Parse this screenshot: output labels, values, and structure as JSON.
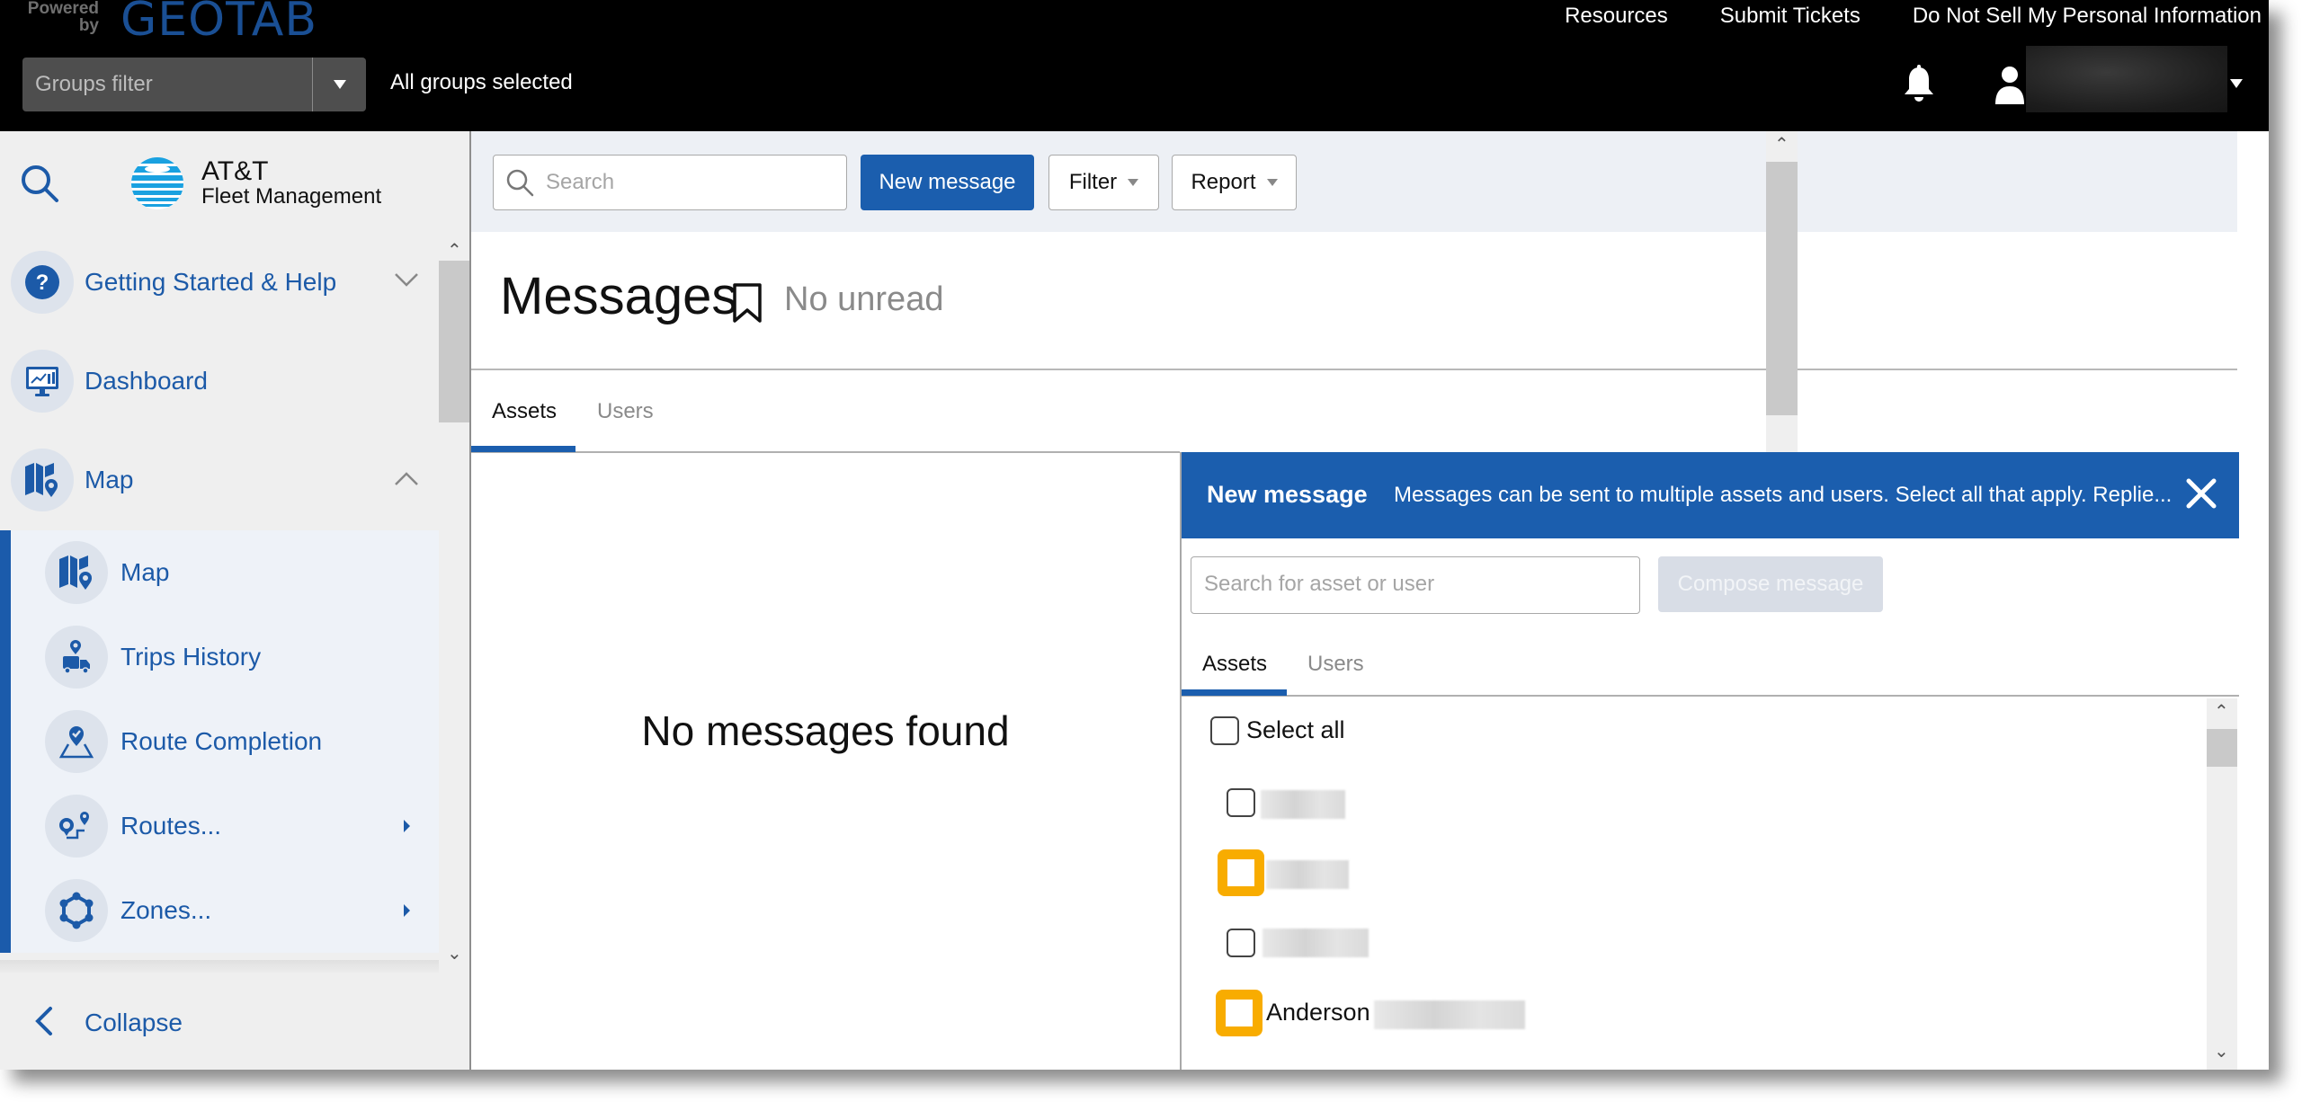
{
  "header": {
    "powered_by": "Powered by",
    "brand": "GEOTAB",
    "links": [
      "Resources",
      "Submit Tickets",
      "Do Not Sell My Personal Information"
    ],
    "groups_filter_label": "Groups filter",
    "groups_status": "All groups selected",
    "user_name": ""
  },
  "sidebar": {
    "logo_title": "AT&T",
    "logo_subtitle": "Fleet Management",
    "items": [
      {
        "label": "Getting Started & Help",
        "icon": "help-icon",
        "state": "collapsed"
      },
      {
        "label": "Dashboard",
        "icon": "dashboard-icon"
      },
      {
        "label": "Map",
        "icon": "map-icon",
        "state": "expanded"
      }
    ],
    "submenu": [
      {
        "label": "Map",
        "icon": "map-icon"
      },
      {
        "label": "Trips History",
        "icon": "trips-history-icon"
      },
      {
        "label": "Route Completion",
        "icon": "route-completion-icon"
      },
      {
        "label": "Routes...",
        "icon": "routes-icon",
        "has_submenu": true
      },
      {
        "label": "Zones...",
        "icon": "zones-icon",
        "has_submenu": true
      }
    ],
    "collapse_label": "Collapse"
  },
  "toolbar": {
    "search_placeholder": "Search",
    "new_message_label": "New message",
    "filter_label": "Filter",
    "report_label": "Report"
  },
  "page": {
    "title": "Messages",
    "unread_status": "No unread",
    "tabs": [
      {
        "label": "Assets",
        "active": true
      },
      {
        "label": "Users",
        "active": false
      }
    ],
    "empty_message": "No messages found"
  },
  "compose": {
    "title": "New message",
    "description": "Messages can be sent to multiple assets and users. Select all that apply. Replie...",
    "search_placeholder": "Search for asset or user",
    "compose_label": "Compose message",
    "tabs": [
      {
        "label": "Assets",
        "active": true
      },
      {
        "label": "Users",
        "active": false
      }
    ],
    "select_all_label": "Select all",
    "items": [
      {
        "name": "",
        "redacted": true,
        "highlighted": false,
        "checked": false
      },
      {
        "name": "",
        "redacted": true,
        "highlighted": true,
        "checked": false
      },
      {
        "name": "",
        "redacted": true,
        "highlighted": false,
        "checked": false
      },
      {
        "name": "Anderson",
        "redacted": true,
        "highlighted": true,
        "checked": false
      }
    ]
  },
  "colors": {
    "accent": "#1b5eae",
    "nav_text": "#1c5aa8",
    "highlight": "#f8ac00",
    "header_bg": "#000000"
  }
}
